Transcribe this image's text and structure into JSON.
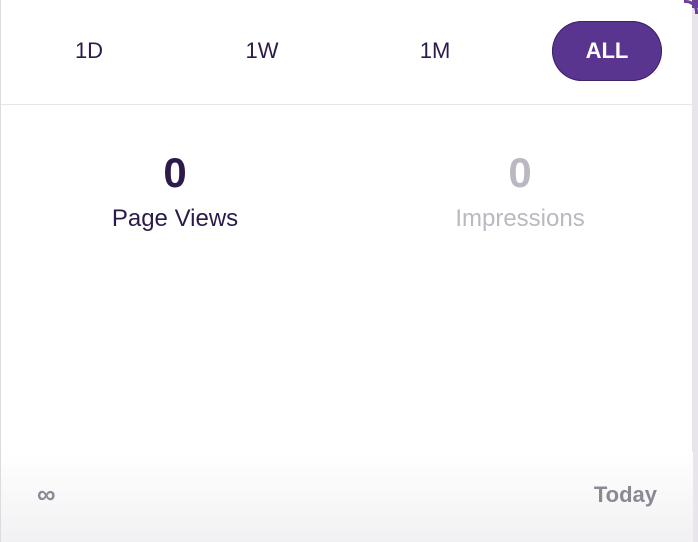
{
  "range_tabs": {
    "items": [
      {
        "label": "1D"
      },
      {
        "label": "1W"
      },
      {
        "label": "1M"
      },
      {
        "label": "ALL"
      }
    ],
    "active": "ALL"
  },
  "stats": {
    "page_views": {
      "value": "0",
      "label": "Page Views"
    },
    "impressions": {
      "value": "0",
      "label": "Impressions"
    }
  },
  "timeline": {
    "start_label": "∞",
    "end_label": "Today"
  },
  "colors": {
    "accent": "#5a3590",
    "primary_text": "#2c1a4a",
    "muted_text": "#bbb8c2",
    "axis_text": "#8c8896"
  }
}
